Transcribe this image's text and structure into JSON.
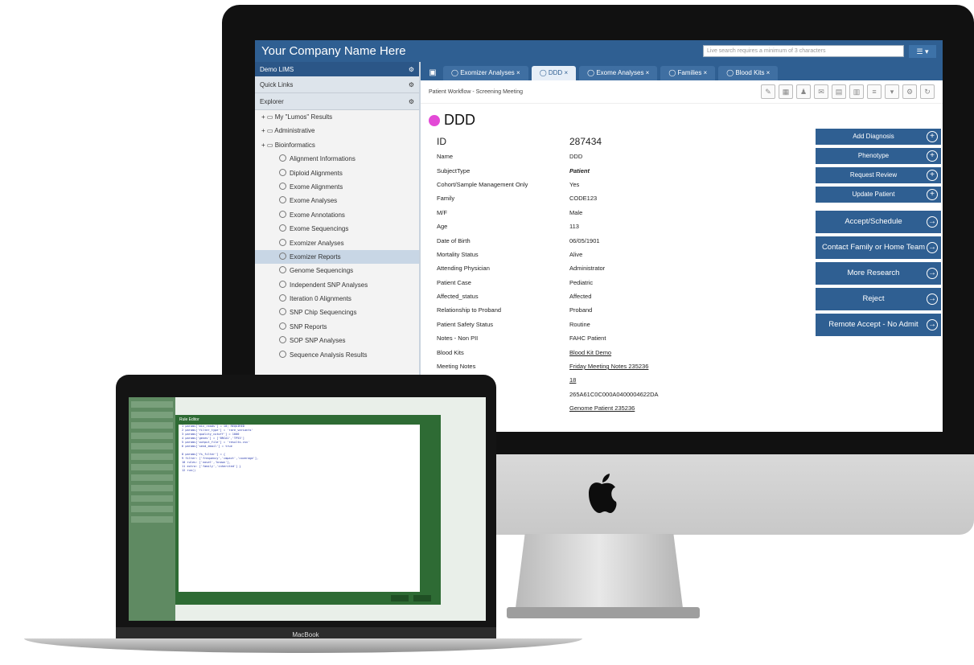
{
  "app": {
    "title": "Your Company Name Here",
    "search_placeholder": "Live search requires a minimum of 3 characters",
    "header_menu": "☰ ▾"
  },
  "sidebar": {
    "top_label": "Demo LIMS",
    "quick_links": "Quick Links",
    "explorer": "Explorer",
    "tree": [
      {
        "label": "My \"Lumos\" Results",
        "level": 0,
        "icon": "folder"
      },
      {
        "label": "Administrative",
        "level": 0,
        "icon": "folder"
      },
      {
        "label": "Bioinformatics",
        "level": 0,
        "icon": "folder"
      },
      {
        "label": "Alignment Informations",
        "level": 1
      },
      {
        "label": "Diploid Alignments",
        "level": 1
      },
      {
        "label": "Exome Alignments",
        "level": 1
      },
      {
        "label": "Exome Analyses",
        "level": 1
      },
      {
        "label": "Exome Annotations",
        "level": 1
      },
      {
        "label": "Exome Sequencings",
        "level": 1
      },
      {
        "label": "Exomizer Analyses",
        "level": 1
      },
      {
        "label": "Exomizer Reports",
        "level": 1,
        "selected": true
      },
      {
        "label": "Genome Sequencings",
        "level": 1
      },
      {
        "label": "Independent SNP Analyses",
        "level": 1
      },
      {
        "label": "Iteration 0 Alignments",
        "level": 1
      },
      {
        "label": "SNP Chip Sequencings",
        "level": 1
      },
      {
        "label": "SNP Reports",
        "level": 1
      },
      {
        "label": "SOP SNP Analyses",
        "level": 1
      },
      {
        "label": "Sequence Analysis Results",
        "level": 1
      }
    ]
  },
  "tabs": [
    {
      "label": "Exomizer Analyses"
    },
    {
      "label": "DDD",
      "active": true
    },
    {
      "label": "Exome Analyses"
    },
    {
      "label": "Families"
    },
    {
      "label": "Blood Kits"
    }
  ],
  "breadcrumb": "Patient Workflow - Screening Meeting",
  "patient": {
    "name": "DDD",
    "fields": [
      {
        "label": "ID",
        "value": "287434",
        "big": true
      },
      {
        "label": "Name",
        "value": "DDD"
      },
      {
        "label": "SubjectType",
        "value": "Patient",
        "style": "bold-italic"
      },
      {
        "label": "Cohort/Sample Management Only",
        "value": "Yes"
      },
      {
        "label": "Family",
        "value": "CODE123"
      },
      {
        "label": "M/F",
        "value": "Male"
      },
      {
        "label": "Age",
        "value": "113"
      },
      {
        "label": "Date of Birth",
        "value": "06/05/1901"
      },
      {
        "label": "Mortality Status",
        "value": "Alive"
      },
      {
        "label": "Attending Physician",
        "value": "Administrator"
      },
      {
        "label": "Patient Case",
        "value": "Pediatric"
      },
      {
        "label": "Affected_status",
        "value": "Affected"
      },
      {
        "label": "Relationship to Proband",
        "value": "Proband"
      },
      {
        "label": "Patient Safety Status",
        "value": "Routine"
      },
      {
        "label": "Notes - Non PII",
        "value": "FAHC Patient"
      },
      {
        "label": "Blood Kits",
        "value": "Blood Kit Demo",
        "link": true
      },
      {
        "label": "Meeting Notes",
        "value": "Friday Meeting Notes 235236",
        "link": true
      },
      {
        "label": "",
        "value": "18",
        "link": true
      },
      {
        "label": "",
        "value": "265A61C0C000A0400004622DA"
      },
      {
        "label": "",
        "value": "Genome Patient 235236",
        "link": true
      }
    ]
  },
  "actions_small": [
    {
      "label": "Add Diagnosis"
    },
    {
      "label": "Phenotype"
    },
    {
      "label": "Request Review"
    },
    {
      "label": "Update Patient"
    }
  ],
  "actions_large": [
    {
      "label": "Accept/Schedule"
    },
    {
      "label": "Contact Family or Home Team"
    },
    {
      "label": "More Research"
    },
    {
      "label": "Reject"
    },
    {
      "label": "Remote Accept - No Admit"
    }
  ],
  "laptop": {
    "brand": "MacBook",
    "modal_title": "Rule Editor",
    "code_lines": [
      "1 params['min_reads'] = 10; REQUIRED",
      "2 params['filter_type'] = 'rare_variants'",
      "3 params['quality_cutoff'] = 1000",
      "4 params['genes'] = ['BRCA1','TP53']",
      "5 params['output_file'] = 'results.csv'",
      "6 params['send_email'] = true",
      "",
      "8 params['fs_filter'] = {",
      "9   filter: ['frequency','impact','coverage'],",
      "10  rules: ['novel','known'],",
      "11  extra: ['family','inherited'] }",
      "12 run()"
    ]
  }
}
